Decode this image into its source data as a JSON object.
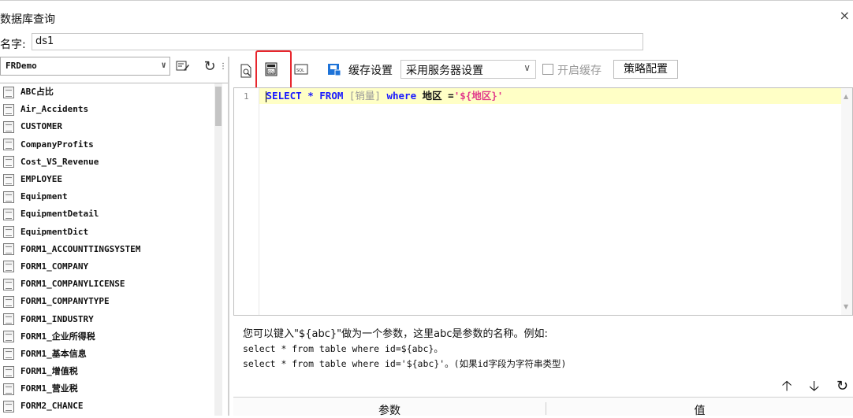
{
  "window": {
    "title": "数据库查询",
    "close_glyph": "×"
  },
  "name_field": {
    "label": "名字:",
    "value": "ds1"
  },
  "datasource": {
    "selected": "FRDemo"
  },
  "tables": [
    "ABC占比",
    "Air_Accidents",
    "CUSTOMER",
    "CompanyProfits",
    "Cost_VS_Revenue",
    "EMPLOYEE",
    "Equipment",
    "EquipmentDetail",
    "EquipmentDict",
    "FORM1_ACCOUNTTINGSYSTEM",
    "FORM1_COMPANY",
    "FORM1_COMPANYLICENSE",
    "FORM1_COMPANYTYPE",
    "FORM1_INDUSTRY",
    "FORM1_企业所得税",
    "FORM1_基本信息",
    "FORM1_增值税",
    "FORM1_营业税",
    "FORM2_CHANCE"
  ],
  "toolbar": {
    "cache_label": "缓存设置",
    "cache_select": "采用服务器设置",
    "enable_cache_label": "开启缓存",
    "policy_button": "策略配置"
  },
  "editor": {
    "line_number": "1",
    "sql": {
      "kw_select": "SELECT",
      "star": " * ",
      "kw_from": "FROM",
      "table": " [销量] ",
      "kw_where": "where",
      "field": " 地区 =",
      "param": "'${地区}'"
    }
  },
  "hint": {
    "line1": "您可以键入\"${abc}\"做为一个参数，这里abc是参数的名称。例如:",
    "line2": "select * from table where id=${abc}。",
    "line3": "select * from table where id='${abc}'。(如果id字段为字符串类型)"
  },
  "params_table": {
    "col_param": "参数",
    "col_value": "值"
  },
  "colors": {
    "highlight": "#e8262d",
    "editor_line": "#ffffc6",
    "keyword": "#1a1aff"
  }
}
